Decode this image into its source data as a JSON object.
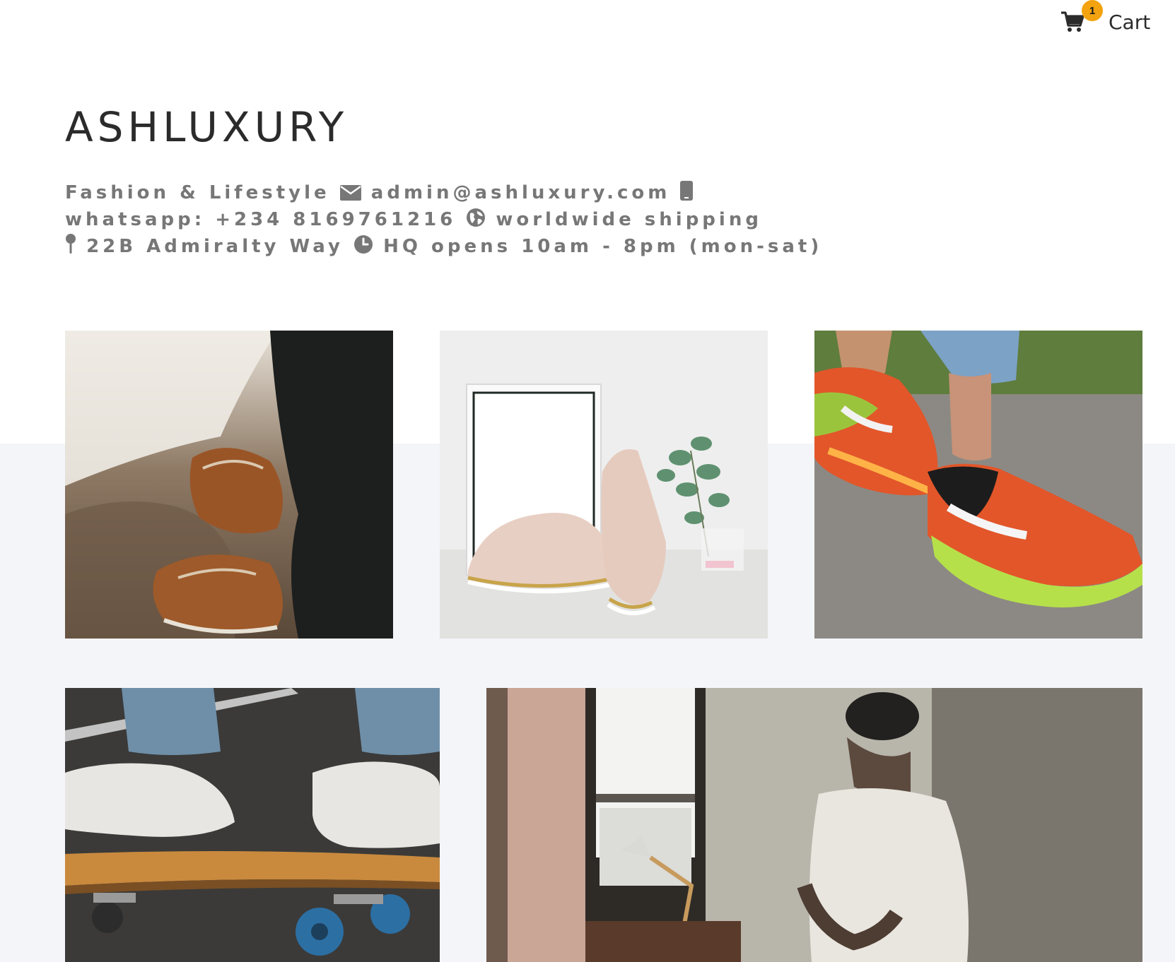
{
  "cart": {
    "label": "Cart",
    "count": "1",
    "icon": "shopping-cart-icon",
    "badge_color": "#f2a30f"
  },
  "header": {
    "brand": "ASHLUXURY",
    "tagline": "Fashion & Lifestyle",
    "email": "admin@ashluxury.com",
    "whatsapp": "whatsapp: +234 8169761216",
    "shipping": "worldwide shipping",
    "address": "22B Admiralty Way",
    "hours": "HQ opens 10am - 8pm (mon-sat)"
  },
  "colors": {
    "text_dark": "#2b2b2b",
    "text_muted": "#777777",
    "band": "#f4f5f9"
  },
  "gallery": [
    {
      "subject": "brown leather boat shoes on rocky ground"
    },
    {
      "subject": "pink brogue shoes beside a frame and eucalyptus"
    },
    {
      "subject": "orange and green running sneakers"
    },
    {
      "subject": "white sneakers on a skateboard"
    },
    {
      "subject": "man in cap leaning against a brick wall"
    }
  ]
}
